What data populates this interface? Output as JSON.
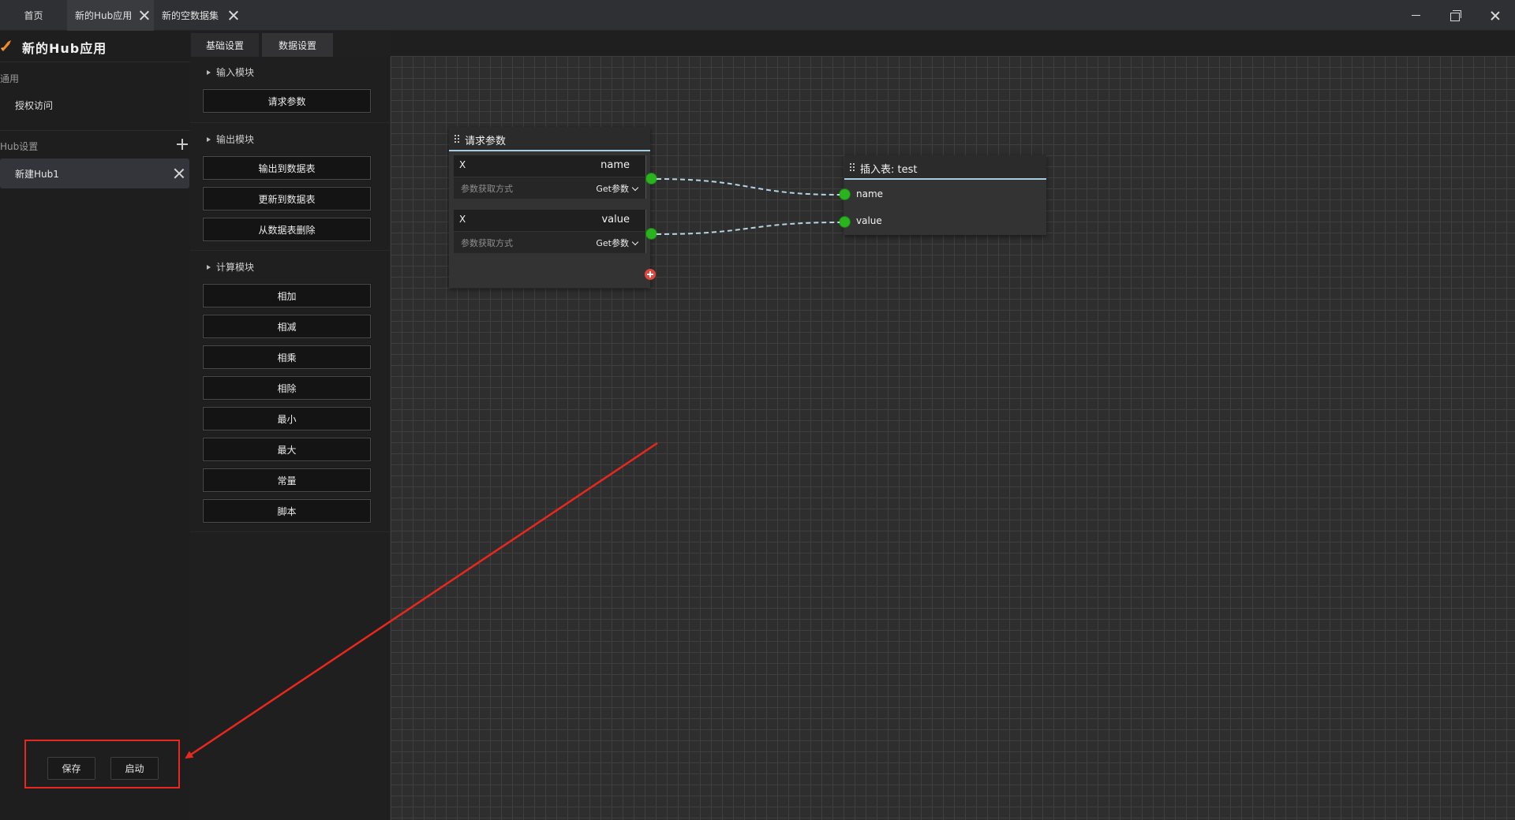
{
  "tabs": {
    "home": "首页",
    "hub_app": "新的Hub应用",
    "dataset": "新的空数据集"
  },
  "sidebar": {
    "app_title": "新的Hub应用",
    "general_label": "通用",
    "auth_access": "授权访问",
    "hub_settings_label": "Hub设置",
    "hub_item": "新建Hub1",
    "save_label": "保存",
    "start_label": "启动"
  },
  "panel": {
    "tabs": [
      "基础设置",
      "数据设置"
    ],
    "groups": {
      "input": {
        "title": "输入模块",
        "items": [
          "请求参数"
        ]
      },
      "output": {
        "title": "输出模块",
        "items": [
          "输出到数据表",
          "更新到数据表",
          "从数据表删除"
        ]
      },
      "compute": {
        "title": "计算模块",
        "items": [
          "相加",
          "相减",
          "相乘",
          "相除",
          "最小",
          "最大",
          "常量",
          "脚本"
        ]
      }
    }
  },
  "nodes": {
    "request": {
      "title": "请求参数",
      "params": [
        {
          "x": "X",
          "name": "name",
          "hint": "参数获取方式",
          "method": "Get参数"
        },
        {
          "x": "X",
          "name": "value",
          "hint": "参数获取方式",
          "method": "Get参数"
        }
      ]
    },
    "insert": {
      "title": "插入表: test",
      "inputs": [
        "name",
        "value"
      ]
    }
  },
  "colors": {
    "accent_header": "#a8cde0",
    "port": "#2bb21f",
    "annotation": "#e8281f",
    "add_button": "#e0473d"
  }
}
